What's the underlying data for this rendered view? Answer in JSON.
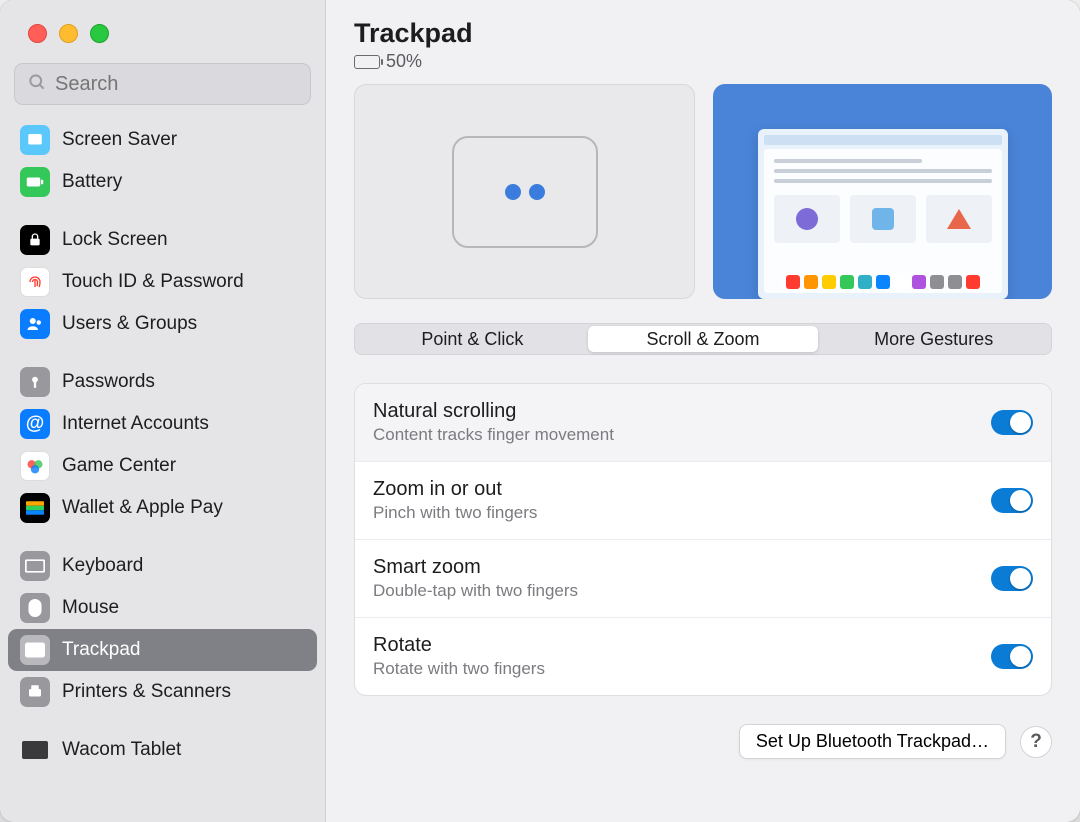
{
  "sidebar": {
    "search_placeholder": "Search",
    "items": [
      {
        "label": "Screen Saver"
      },
      {
        "label": "Battery"
      },
      null,
      {
        "label": "Lock Screen"
      },
      {
        "label": "Touch ID & Password"
      },
      {
        "label": "Users & Groups"
      },
      null,
      {
        "label": "Passwords"
      },
      {
        "label": "Internet Accounts"
      },
      {
        "label": "Game Center"
      },
      {
        "label": "Wallet & Apple Pay"
      },
      null,
      {
        "label": "Keyboard"
      },
      {
        "label": "Mouse"
      },
      {
        "label": "Trackpad"
      },
      {
        "label": "Printers & Scanners"
      },
      null,
      {
        "label": "Wacom Tablet"
      }
    ]
  },
  "page": {
    "title": "Trackpad",
    "battery": "50%",
    "tabs": [
      "Point & Click",
      "Scroll & Zoom",
      "More Gestures"
    ],
    "active_tab": 1,
    "settings": [
      {
        "title": "Natural scrolling",
        "sub": "Content tracks finger movement",
        "on": true
      },
      {
        "title": "Zoom in or out",
        "sub": "Pinch with two fingers",
        "on": true
      },
      {
        "title": "Smart zoom",
        "sub": "Double-tap with two fingers",
        "on": true
      },
      {
        "title": "Rotate",
        "sub": "Rotate with two fingers",
        "on": true
      }
    ],
    "footer_button": "Set Up Bluetooth Trackpad…",
    "help": "?"
  }
}
